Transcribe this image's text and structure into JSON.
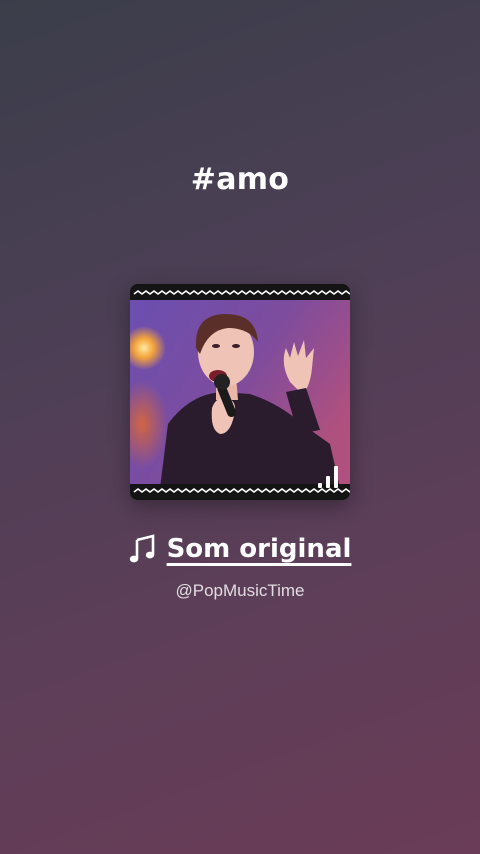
{
  "hashtag": "#amo",
  "sound": {
    "icon": "music-note-icon",
    "title": "Som original",
    "handle": "@PopMusicTime"
  },
  "card": {
    "image_description_icon": "video-thumbnail",
    "equalizer_icon": "equalizer-bars-icon"
  },
  "colors": {
    "background_top": "#3b3e4a",
    "background_bottom": "#6a3c57",
    "text": "#ffffff"
  }
}
